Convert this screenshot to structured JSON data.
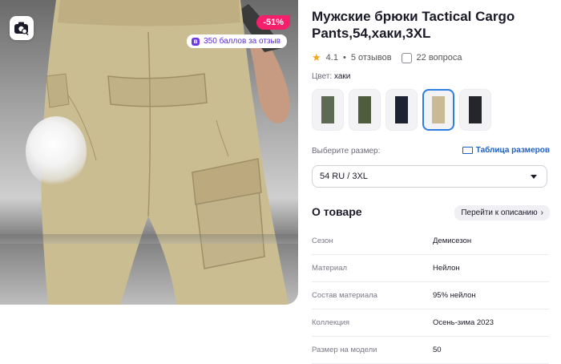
{
  "product": {
    "title": "Мужские брюки Tactical Cargo Pants,54,хаки,3XL",
    "rating": "4.1",
    "reviews": "5 отзывов",
    "questions": "22 вопроса",
    "discount": "-51%",
    "points_badge": "350 баллов за отзыв"
  },
  "color": {
    "label": "Цвет:",
    "value": "хаки",
    "swatches": [
      {
        "color": "#5d6b55"
      },
      {
        "color": "#4f5d3e"
      },
      {
        "color": "#1e2333"
      },
      {
        "color": "#c9b995",
        "selected": true
      },
      {
        "color": "#25262b"
      }
    ]
  },
  "size": {
    "label": "Выберите размер:",
    "table_link": "Таблица размеров",
    "selected": "54 RU / 3XL"
  },
  "about": {
    "heading": "О товаре",
    "to_description": "Перейти к описанию",
    "props": [
      {
        "name": "Сезон",
        "value": "Демисезон"
      },
      {
        "name": "Материал",
        "value": "Нейлон"
      },
      {
        "name": "Состав материала",
        "value": "95% нейлон"
      },
      {
        "name": "Коллекция",
        "value": "Осень-зима 2023"
      },
      {
        "name": "Размер на модели",
        "value": "50"
      }
    ]
  },
  "icons": {
    "camera_search": "camera-search-icon",
    "star": "star-icon",
    "question": "question-icon",
    "ruler": "ruler-icon",
    "chevron_right": "chevron-right-icon",
    "chevron_down": "chevron-down-icon"
  }
}
